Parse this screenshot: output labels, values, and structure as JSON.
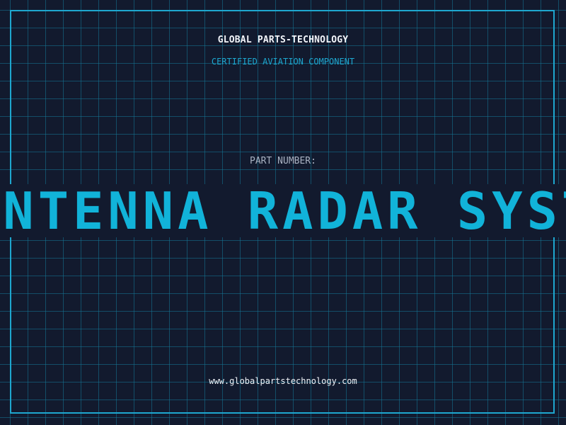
{
  "header": {
    "company": "GLOBAL PARTS-TECHNOLOGY",
    "subtitle": "CERTIFIED AVIATION COMPONENT"
  },
  "part": {
    "label": "PART NUMBER:",
    "name": "ANTENNA RADAR SYSTEM"
  },
  "footer": {
    "website": "www.globalpartstechnology.com"
  },
  "colors": {
    "background": "#121a2e",
    "accent": "#1ea7cf",
    "part_name": "#11b3d9",
    "grid": "#147696"
  }
}
